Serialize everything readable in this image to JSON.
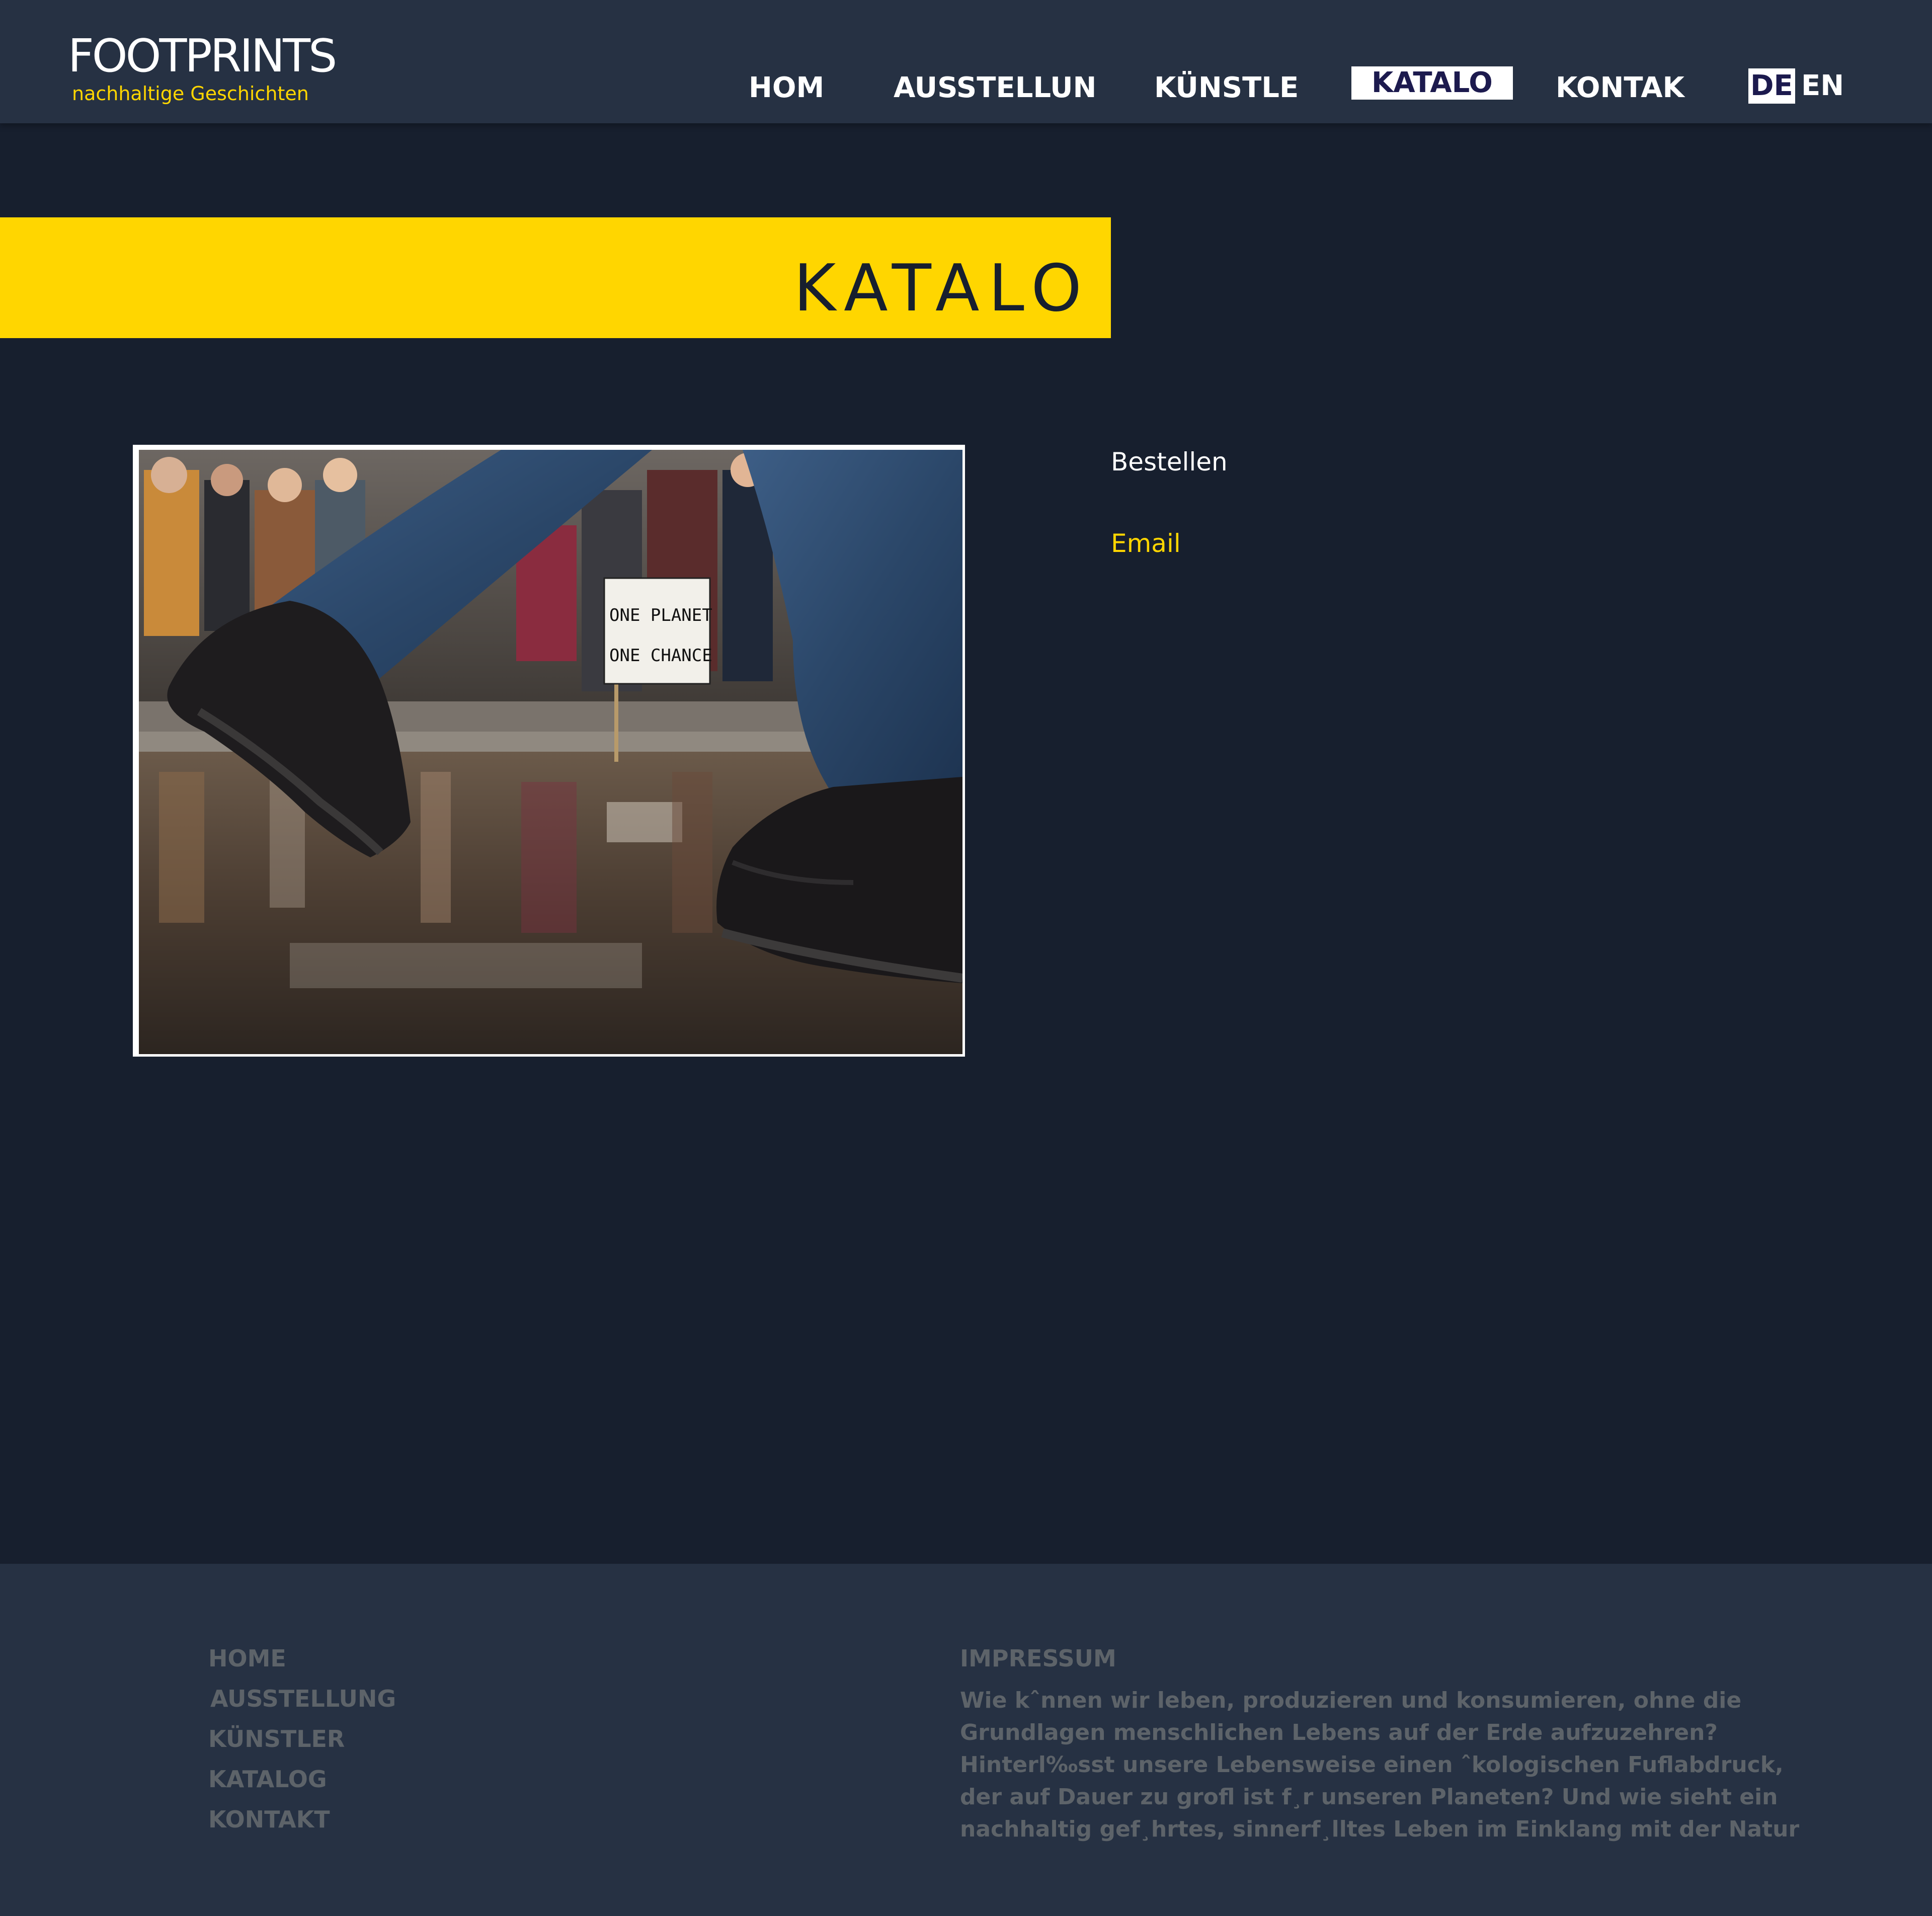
{
  "brand": {
    "title": "FOOTPRINTS",
    "subtitle": "nachhaltige Geschichten"
  },
  "nav": {
    "items": [
      {
        "label": "HOM",
        "active": false
      },
      {
        "label": "AUSSTELLUN",
        "active": false
      },
      {
        "label": "KÜNSTLE",
        "active": false
      },
      {
        "label": "KATALO",
        "active": true
      },
      {
        "label": "KONTAK",
        "active": false
      }
    ],
    "lang": {
      "de": "DE",
      "en": "EN",
      "selected": "DE"
    }
  },
  "banner": {
    "title": "KATALO"
  },
  "photo": {
    "sign_line1": "ONE PLANET",
    "sign_line2": "ONE CHANCE"
  },
  "order": {
    "label": "Bestellen",
    "link": "Email"
  },
  "footer": {
    "links": [
      "HOME",
      "AUSSTELLUNG",
      "KÜNSTLER",
      "KATALOG",
      "KONTAKT"
    ],
    "heading": "IMPRESSUM",
    "lines": [
      "Wie kˆnnen wir leben, produzieren und konsumieren, ohne die",
      "Grundlagen menschlichen Lebens auf der Erde aufzuzehren?",
      "Hinterl‰sst unsere Lebensweise einen ˆkologischen Fuflabdruck,",
      "der auf Dauer zu grofl ist f¸r unseren Planeten? Und wie sieht ein",
      "nachhaltig gef¸hrtes, sinnerf¸lltes Leben im Einklang mit der Natur"
    ]
  },
  "colors": {
    "background": "#171f2e",
    "header": "#263143",
    "accent": "#ffd600",
    "footer_text": "#5d6369",
    "active_nav_text": "#1c1a4e"
  }
}
